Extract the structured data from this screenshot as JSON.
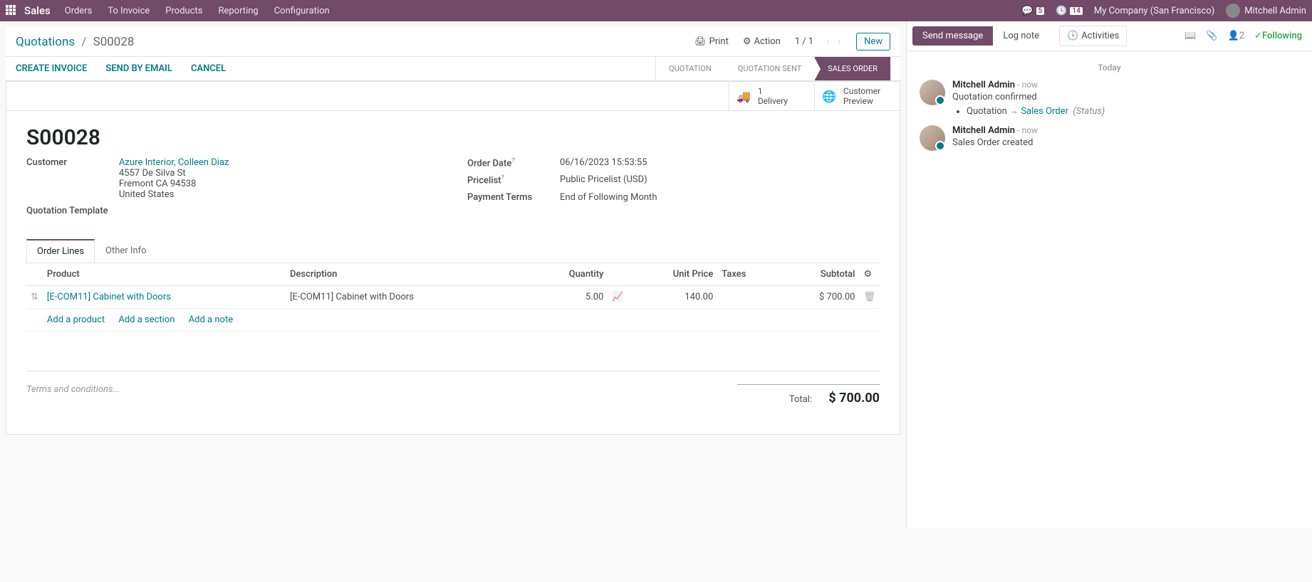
{
  "nav": {
    "app": "Sales",
    "menus": [
      "Orders",
      "To Invoice",
      "Products",
      "Reporting",
      "Configuration"
    ],
    "discuss_count": "5",
    "activities_count": "14",
    "company": "My Company (San Francisco)",
    "user": "Mitchell Admin"
  },
  "controlbar": {
    "breadcrumb_root": "Quotations",
    "breadcrumb_current": "S00028",
    "print": "Print",
    "action": "Action",
    "pager": "1 / 1",
    "new": "New"
  },
  "statusbar": {
    "buttons": [
      "Create Invoice",
      "Send by Email",
      "Cancel"
    ],
    "steps": [
      "Quotation",
      "Quotation Sent",
      "Sales Order"
    ],
    "active_step": 2
  },
  "stat_buttons": {
    "delivery_count": "1",
    "delivery_label": "Delivery",
    "preview_label_1": "Customer",
    "preview_label_2": "Preview"
  },
  "record": {
    "name": "S00028",
    "customer_label": "Customer",
    "customer_name": "Azure Interior, Colleen Diaz",
    "address_line1": "4557 De Silva St",
    "address_line2": "Fremont CA 94538",
    "address_line3": "United States",
    "qt_label": "Quotation Template",
    "orderdate_label": "Order Date",
    "orderdate_value": "06/16/2023 15:53:55",
    "pricelist_label": "Pricelist",
    "pricelist_value": "Public Pricelist (USD)",
    "payterms_label": "Payment Terms",
    "payterms_value": "End of Following Month"
  },
  "tabs": {
    "order_lines": "Order Lines",
    "other_info": "Other Info"
  },
  "columns": {
    "product": "Product",
    "description": "Description",
    "quantity": "Quantity",
    "unitprice": "Unit Price",
    "taxes": "Taxes",
    "subtotal": "Subtotal"
  },
  "line": {
    "product": "[E-COM11] Cabinet with Doors",
    "description": "[E-COM11] Cabinet with Doors",
    "quantity": "5.00",
    "unitprice": "140.00",
    "subtotal": "$ 700.00"
  },
  "line_actions": {
    "add_product": "Add a product",
    "add_section": "Add a section",
    "add_note": "Add a note"
  },
  "footer": {
    "terms_placeholder": "Terms and conditions...",
    "total_label": "Total:",
    "total_value": "$ 700.00"
  },
  "chatter": {
    "send": "Send message",
    "log": "Log note",
    "activities": "Activities",
    "followers": "2",
    "following": "Following",
    "date_header": "Today",
    "msg1_author": "Mitchell Admin",
    "msg1_time": "- now",
    "msg1_text": "Quotation confirmed",
    "msg1_change_from": "Quotation",
    "msg1_change_to": "Sales Order",
    "msg1_change_field": "(Status)",
    "msg2_author": "Mitchell Admin",
    "msg2_time": "- now",
    "msg2_text": "Sales Order created"
  }
}
